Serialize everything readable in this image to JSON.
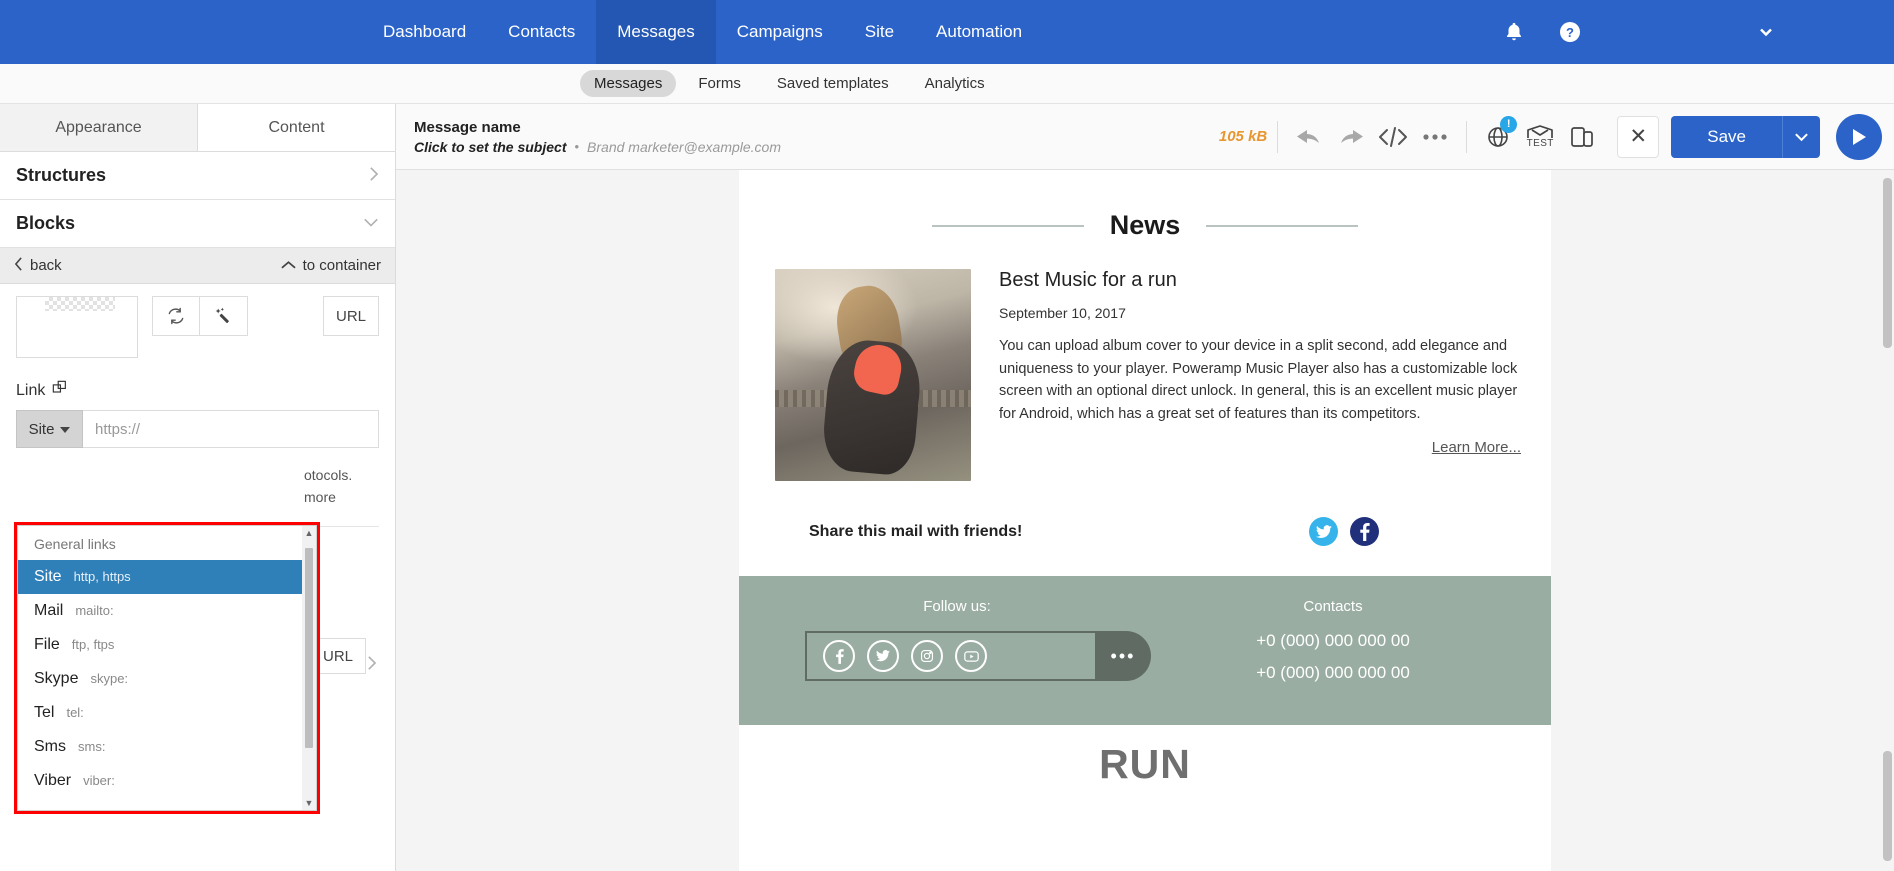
{
  "topnav": {
    "items": [
      {
        "label": "Dashboard",
        "active": false
      },
      {
        "label": "Contacts",
        "active": false
      },
      {
        "label": "Messages",
        "active": true
      },
      {
        "label": "Campaigns",
        "active": false
      },
      {
        "label": "Site",
        "active": false
      },
      {
        "label": "Automation",
        "active": false
      }
    ],
    "bell_icon": "bell-icon",
    "help_icon": "help-circle-icon",
    "account_caret": "chevron-down-icon",
    "background_color": "#2b63c9"
  },
  "subnav": {
    "items": [
      {
        "label": "Messages",
        "active": true
      },
      {
        "label": "Forms",
        "active": false
      },
      {
        "label": "Saved templates",
        "active": false
      },
      {
        "label": "Analytics",
        "active": false
      }
    ]
  },
  "sidebar": {
    "tabs": [
      {
        "label": "Appearance",
        "active": true
      },
      {
        "label": "Content",
        "active": false
      }
    ],
    "sections": [
      {
        "label": "Structures",
        "chevron": "›"
      },
      {
        "label": "Blocks",
        "chevron": "⌵"
      }
    ],
    "backbar": {
      "back_label": "back",
      "container_label": "to container"
    },
    "image_tools": {
      "replace_icon": "refresh-image-icon",
      "edit_icon": "magic-wand-icon",
      "url_button": "URL"
    },
    "link": {
      "label": "Link",
      "copy_icon": "duplicate-icon",
      "protocol_value": "Site",
      "url_placeholder": "https://",
      "hint_fragment_1": "otocols.",
      "hint_fragment_2": "more"
    },
    "filename": "ed.png",
    "bottom_url_button": "URL",
    "bottom_chevron": "›"
  },
  "dropdown": {
    "group_label": "General links",
    "options": [
      {
        "name": "Site",
        "scheme": "http, https",
        "selected": true
      },
      {
        "name": "Mail",
        "scheme": "mailto:",
        "selected": false
      },
      {
        "name": "File",
        "scheme": "ftp, ftps",
        "selected": false
      },
      {
        "name": "Skype",
        "scheme": "skype:",
        "selected": false
      },
      {
        "name": "Tel",
        "scheme": "tel:",
        "selected": false
      },
      {
        "name": "Sms",
        "scheme": "sms:",
        "selected": false
      },
      {
        "name": "Viber",
        "scheme": "viber:",
        "selected": false
      }
    ],
    "highlight_border_color": "#ff0000",
    "selected_bg_color": "#2f7fb8",
    "scroll_up_arrow": "▲",
    "scroll_down_arrow": "▼"
  },
  "toolbar": {
    "message_name": "Message name",
    "subject_prompt": "Click to set the subject",
    "separator_dot": "•",
    "from": "Brand marketer@example.com",
    "size": "105 kB",
    "size_color": "#e8962f",
    "icons": [
      {
        "name": "undo-icon",
        "glyph": "↶"
      },
      {
        "name": "redo-icon",
        "glyph": "↷"
      },
      {
        "name": "code-icon",
        "glyph": "</>"
      },
      {
        "name": "more-icon",
        "glyph": "•••"
      }
    ],
    "globe_icon": "globe-icon",
    "globe_badge": "!",
    "test_icon_label": "TEST",
    "preview_icon": "device-preview-icon",
    "close_label": "✕",
    "save_label": "Save",
    "save_caret": "⌵",
    "play_label": "▶"
  },
  "email": {
    "heading": "News",
    "article": {
      "title": "Best Music for a run",
      "date": "September 10, 2017",
      "body": "You can upload album cover to your device in a split second, add elegance and uniqueness to your player. Poweramp Music Player also has a customizable lock screen with an optional direct unlock. In general, this is an excellent music player for Android, which has a great set of features than its competitors.",
      "learn_more": "Learn More..."
    },
    "share": {
      "text": "Share this mail with friends!",
      "icons": [
        {
          "name": "twitter-icon",
          "glyph": "🐦"
        },
        {
          "name": "facebook-icon",
          "glyph": "f"
        }
      ]
    },
    "footer": {
      "follow_title": "Follow us:",
      "social": [
        {
          "name": "facebook-icon",
          "glyph": "f"
        },
        {
          "name": "twitter-icon",
          "glyph": "🐦"
        },
        {
          "name": "instagram-icon",
          "glyph": "◎"
        },
        {
          "name": "youtube-icon",
          "glyph": "▶"
        }
      ],
      "more_glyph": "•••",
      "contacts_title": "Contacts",
      "phone_1": "+0 (000) 000 000 00",
      "phone_2": "+0 (000) 000 000 00",
      "background_color": "#9aada2"
    },
    "run_text": "RUN"
  }
}
